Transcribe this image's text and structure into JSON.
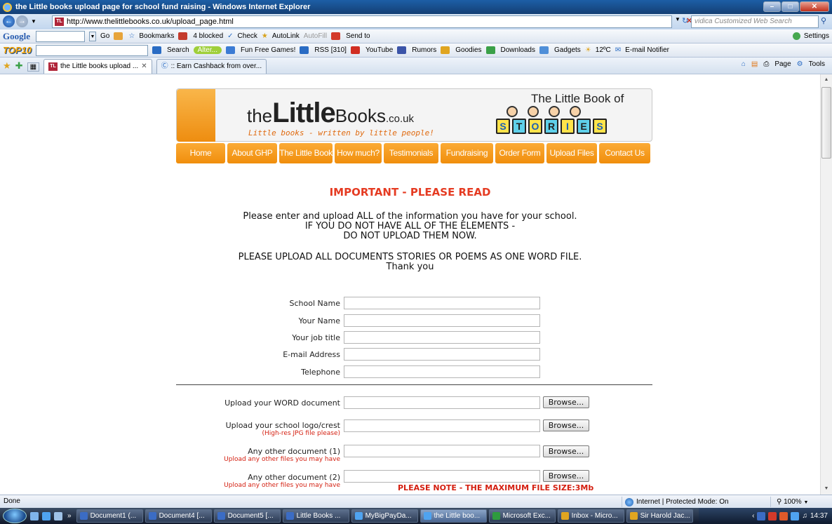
{
  "window": {
    "title": "the Little books upload page for school fund raising - Windows Internet Explorer"
  },
  "address": {
    "url": "http://www.thelittlebooks.co.uk/upload_page.html",
    "search_placeholder": "vidica Customized Web Search"
  },
  "google_toolbar": {
    "logo": "Google",
    "go": "Go",
    "bookmarks": "Bookmarks",
    "blocked": "4 blocked",
    "check": "Check",
    "autolink": "AutoLink",
    "autofill": "AutoFill",
    "sendto": "Send to",
    "settings": "Settings"
  },
  "top10_toolbar": {
    "logo": "TOP10",
    "search": "Search",
    "alter": "Alter...",
    "games": "Fun Free Games!",
    "rss": "RSS [310]",
    "youtube": "YouTube",
    "rumors": "Rumors",
    "goodies": "Goodies",
    "downloads": "Downloads",
    "gadgets": "Gadgets",
    "weather": "12ºC",
    "email_notifier": "E-mail Notifier"
  },
  "tabs": [
    {
      "label": "the Little books upload ..."
    },
    {
      "label": ":: Earn Cashback from over..."
    }
  ],
  "command_bar": {
    "page": "Page",
    "tools": "Tools"
  },
  "site": {
    "logo_the": "the",
    "logo_little": "Little",
    "logo_books": "Books",
    "logo_couk": ".co.uk",
    "tagline": "Little books - written by little people!",
    "book_of": "The Little Book of",
    "stories_letters": [
      "S",
      "T",
      "O",
      "R",
      "I",
      "E",
      "S"
    ],
    "nav": [
      "Home",
      "About GHP",
      "The Little Book",
      "How much?",
      "Testimonials",
      "Fundraising",
      "Order Form",
      "Upload Files",
      "Contact Us"
    ]
  },
  "page": {
    "important": "IMPORTANT - PLEASE READ",
    "instr_1": "Please enter and upload ALL of the information you have for your school.",
    "instr_2": "IF YOU DO NOT HAVE ALL OF THE ELEMENTS -",
    "instr_3": "DO NOT UPLOAD THEM NOW.",
    "instr_4": "PLEASE UPLOAD ALL DOCUMENTS STORIES OR POEMS AS ONE WORD FILE.",
    "instr_5": "Thank you",
    "fields": {
      "school_name": "School Name",
      "your_name": "Your Name",
      "job_title": "Your job title",
      "email": "E-mail Address",
      "telephone": "Telephone"
    },
    "uploads": {
      "word_doc": "Upload your WORD document",
      "logo": "Upload your school logo/crest",
      "logo_note": "(High-res JPG file please)",
      "other1": "Any other document (1)",
      "other1_note": "Upload any other files you may have",
      "other2": "Any other document (2)",
      "other2_note": "Upload any other files you may have",
      "browse": "Browse..."
    },
    "max_note": "PLEASE NOTE - THE MAXIMUM FILE SIZE:3Mb"
  },
  "status": {
    "left": "Done",
    "zone": "Internet | Protected Mode: On",
    "zoom": "100%"
  },
  "taskbar": {
    "items": [
      "Document1 (...",
      "Document4 [...",
      "Document5 [...",
      "Little Books ...",
      "MyBigPayDa...",
      "the Little boo...",
      "Microsoft Exc...",
      "Inbox - Micro...",
      "Sir Harold Jac..."
    ],
    "clock": "14:37"
  }
}
